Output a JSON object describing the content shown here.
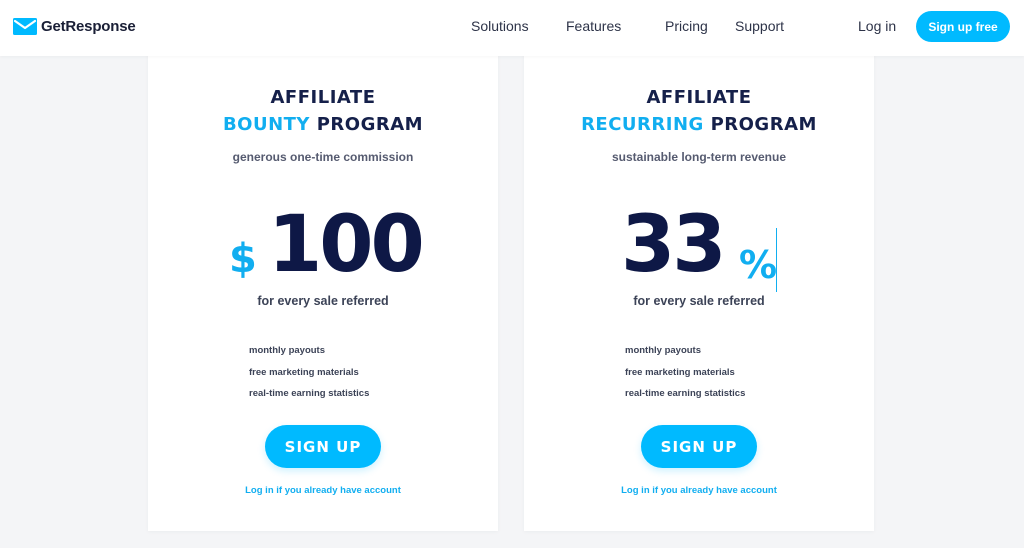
{
  "header": {
    "logo_text": "GetResponse",
    "nav": {
      "solutions": "Solutions",
      "features": "Features",
      "pricing": "Pricing",
      "support": "Support",
      "login": "Log in"
    },
    "signup_label": "Sign up free"
  },
  "cards": {
    "bounty": {
      "title_line1": "AFFILIATE",
      "title_accent": "BOUNTY",
      "title_rest": " PROGRAM",
      "subtitle": "generous one-time commission",
      "currency_symbol": "$",
      "amount": "100",
      "per_sale": "for every sale referred",
      "features": [
        "monthly payouts",
        "free marketing materials",
        "real-time earning statistics"
      ],
      "cta_label": "SIGN UP",
      "login_link": "Log in if you already have account"
    },
    "recurring": {
      "title_line1": "AFFILIATE",
      "title_accent": "RECURRING",
      "title_rest": " PROGRAM",
      "subtitle": "sustainable long-term revenue",
      "amount": "33",
      "percent_symbol": "%",
      "per_sale": "for every sale referred",
      "features": [
        "monthly payouts",
        "free marketing materials",
        "real-time earning statistics"
      ],
      "cta_label": "SIGN UP",
      "login_link": "Log in if you already have account"
    }
  },
  "colors": {
    "accent": "#00baff",
    "navy": "#0e1846",
    "background": "#f4f5f7"
  },
  "icons": {
    "logo": "envelope-logo-icon"
  }
}
